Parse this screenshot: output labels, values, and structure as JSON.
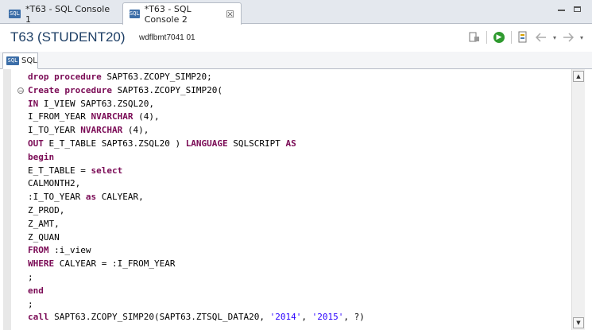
{
  "tabs": [
    {
      "icon": "SQL",
      "label": "*T63 - SQL Console 1"
    },
    {
      "icon": "SQL",
      "label": "*T63 - SQL Console 2",
      "close": "☒"
    }
  ],
  "header": {
    "title": "T63 (STUDENT20)",
    "host": "wdflbmt7041 01"
  },
  "subtab": {
    "icon": "SQL",
    "label": "SQL"
  },
  "code": [
    [
      {
        "t": "drop procedure",
        "k": true
      },
      {
        "t": " SAPT63.ZCOPY_SIMP20;"
      }
    ],
    [
      {
        "t": "Create procedure",
        "k": true
      },
      {
        "t": " SAPT63.ZCOPY_SIMP20("
      }
    ],
    [
      {
        "t": "IN",
        "k": true
      },
      {
        "t": " I_VIEW SAPT63.ZSQL20,"
      }
    ],
    [
      {
        "t": "I_FROM_YEAR "
      },
      {
        "t": "NVARCHAR",
        "k": true
      },
      {
        "t": " (4),"
      }
    ],
    [
      {
        "t": "I_TO_YEAR "
      },
      {
        "t": "NVARCHAR",
        "k": true
      },
      {
        "t": " (4),"
      }
    ],
    [
      {
        "t": "OUT",
        "k": true
      },
      {
        "t": " E_T_TABLE SAPT63.ZSQL20 ) "
      },
      {
        "t": "LANGUAGE",
        "k": true
      },
      {
        "t": " SQLSCRIPT "
      },
      {
        "t": "AS",
        "k": true
      }
    ],
    [
      {
        "t": "begin",
        "k": true
      }
    ],
    [
      {
        "t": "E_T_TABLE = "
      },
      {
        "t": "select",
        "k": true
      }
    ],
    [
      {
        "t": "CALMONTH2,"
      }
    ],
    [
      {
        "t": ":I_TO_YEAR "
      },
      {
        "t": "as",
        "k": true
      },
      {
        "t": " CALYEAR,"
      }
    ],
    [
      {
        "t": "Z_PROD,"
      }
    ],
    [
      {
        "t": "Z_AMT,"
      }
    ],
    [
      {
        "t": "Z_QUAN"
      }
    ],
    [
      {
        "t": "FROM",
        "k": true
      },
      {
        "t": " :i_view"
      }
    ],
    [
      {
        "t": "WHERE",
        "k": true
      },
      {
        "t": " CALYEAR = :I_FROM_YEAR"
      }
    ],
    [
      {
        "t": ";"
      }
    ],
    [
      {
        "t": "end",
        "k": true
      }
    ],
    [
      {
        "t": ";"
      }
    ],
    [
      {
        "t": "call",
        "k": true
      },
      {
        "t": " SAPT63.ZCOPY_SIMP20(SAPT63.ZTSQL_DATA20, "
      },
      {
        "t": "'2014'",
        "s": true
      },
      {
        "t": ", "
      },
      {
        "t": "'2015'",
        "s": true
      },
      {
        "t": ", ?)"
      }
    ]
  ]
}
